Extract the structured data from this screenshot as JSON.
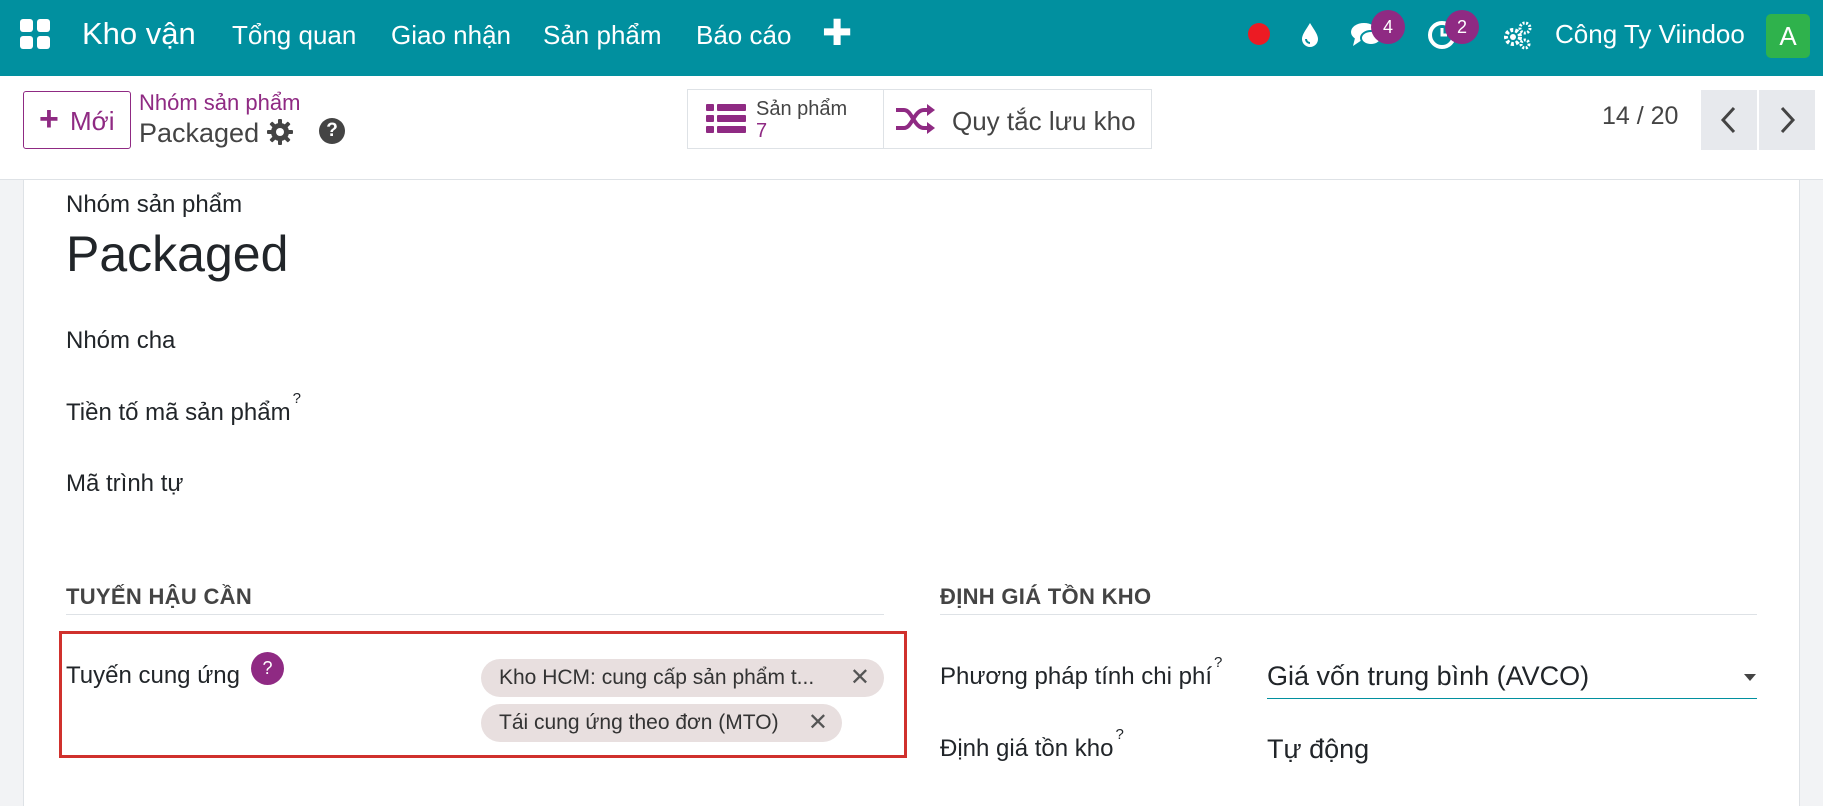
{
  "navbar": {
    "app_name": "Kho vận",
    "menu": [
      "Tổng quan",
      "Giao nhận",
      "Sản phẩm",
      "Báo cáo"
    ],
    "plus": "✚",
    "messages_count": "4",
    "activities_count": "2",
    "company": "Công Ty Viindoo",
    "avatar_letter": "A"
  },
  "control": {
    "new_button_icon": "+",
    "new_button_label": "Mới",
    "breadcrumb_parent": "Nhóm sản phẩm",
    "breadcrumb_current": "Packaged",
    "smart_products_title": "Sản phẩm",
    "smart_products_value": "7",
    "smart_putaway_label": "Quy tắc lưu kho",
    "pager": "14 / 20"
  },
  "form": {
    "name_label": "Nhóm sản phẩm",
    "name_value": "Packaged",
    "parent_label": "Nhóm cha",
    "prefix_label": "Tiền tố mã sản phẩm",
    "sequence_label": "Mã trình tự",
    "logistics_title": "TUYẾN HẬU CẦN",
    "routes_label": "Tuyến cung ứng",
    "routes_help": "?",
    "routes": [
      "Kho HCM: cung cấp sản phẩm t...",
      "Tái cung ứng theo đơn (MTO)"
    ],
    "valuation_title": "ĐỊNH GIÁ TỒN KHO",
    "cost_method_label": "Phương pháp tính chi phí",
    "cost_method_value": "Giá vốn trung bình (AVCO)",
    "valuation_label": "Định giá tồn kho",
    "valuation_value": "Tự động",
    "help_mark": "?",
    "tag_remove": "✕"
  },
  "colors": {
    "navbar": "#01909f",
    "primary": "#8f2a83",
    "highlight_border": "#d0312d",
    "record_dot": "#ec1b23",
    "avatar": "#2fb24c"
  }
}
